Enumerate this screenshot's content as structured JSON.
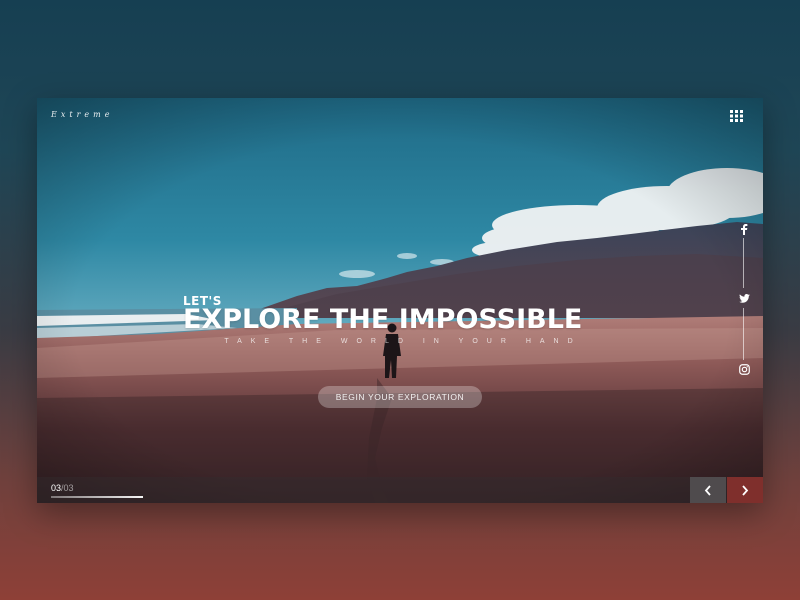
{
  "brand": {
    "logo_text": "Extreme"
  },
  "header": {
    "menu_icon": "grid-menu-icon"
  },
  "hero": {
    "pretitle": "LET'S",
    "title": "EXPLORE THE IMPOSSIBLE",
    "subtitle": "TAKE THE WORLD IN YOUR HAND",
    "cta_label": "BEGIN YOUR EXPLORATION"
  },
  "social": {
    "items": [
      {
        "name": "facebook-icon"
      },
      {
        "name": "twitter-icon"
      },
      {
        "name": "instagram-icon"
      }
    ]
  },
  "slider": {
    "current": "03",
    "total": "/03",
    "progress": 1.0,
    "prev_icon": "chevron-left-icon",
    "next_icon": "chevron-right-icon"
  },
  "colors": {
    "accent": "#7f2f2c",
    "prev_button": "#4f4b4d"
  }
}
